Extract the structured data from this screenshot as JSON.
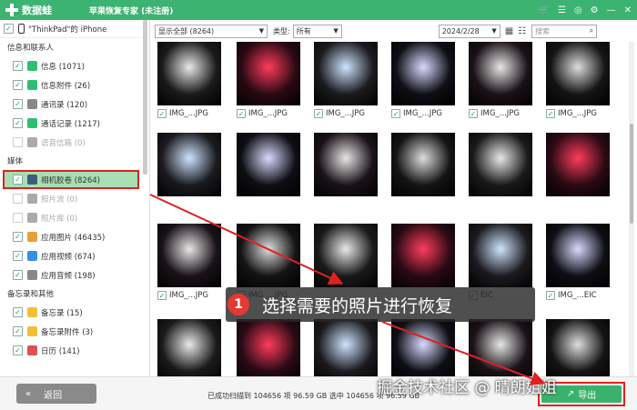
{
  "titlebar": {
    "logo_text": "数据蛙",
    "app_title": "苹果恢复专家 (未注册)",
    "controls": [
      "cart-icon",
      "menu-icon",
      "chat-icon",
      "settings-icon",
      "minimize-icon",
      "close-icon"
    ]
  },
  "device": {
    "name": "\"ThinkPad\"的 iPhone"
  },
  "sidebar": {
    "groups": [
      {
        "title": "信息和联系人",
        "items": [
          {
            "label": "信息 (1071)",
            "checked": true,
            "disabled": false,
            "icon": "message-icon",
            "color": "#2fbf71"
          },
          {
            "label": "信息附件 (26)",
            "checked": true,
            "disabled": false,
            "icon": "attachment-icon",
            "color": "#2fbf71"
          },
          {
            "label": "通讯录 (120)",
            "checked": true,
            "disabled": false,
            "icon": "contacts-icon",
            "color": "#888888"
          },
          {
            "label": "通话记录 (1217)",
            "checked": true,
            "disabled": false,
            "icon": "phone-icon",
            "color": "#2fbf71"
          },
          {
            "label": "语音信箱 (0)",
            "checked": false,
            "disabled": true,
            "icon": "voicemail-icon",
            "color": "#aaaaaa"
          }
        ]
      },
      {
        "title": "媒体",
        "items": [
          {
            "label": "相机胶卷 (8264)",
            "checked": true,
            "disabled": false,
            "icon": "camera-roll-icon",
            "color": "#3b5d7a",
            "selected": true
          },
          {
            "label": "照片流 (0)",
            "checked": false,
            "disabled": true,
            "icon": "photo-stream-icon",
            "color": "#aaaaaa"
          },
          {
            "label": "照片库 (0)",
            "checked": false,
            "disabled": true,
            "icon": "photo-library-icon",
            "color": "#aaaaaa"
          },
          {
            "label": "应用图片 (46435)",
            "checked": true,
            "disabled": false,
            "icon": "app-photos-icon",
            "color": "#e7a13a"
          },
          {
            "label": "应用视频 (674)",
            "checked": true,
            "disabled": false,
            "icon": "app-video-icon",
            "color": "#3a8fe7"
          },
          {
            "label": "应用音频 (198)",
            "checked": true,
            "disabled": false,
            "icon": "music-icon",
            "color": "#888888"
          }
        ]
      },
      {
        "title": "备忘录和其他",
        "items": [
          {
            "label": "备忘录 (15)",
            "checked": true,
            "disabled": false,
            "icon": "notes-icon",
            "color": "#f2c037"
          },
          {
            "label": "备忘录附件 (3)",
            "checked": true,
            "disabled": false,
            "icon": "notes-attachment-icon",
            "color": "#f2c037"
          },
          {
            "label": "日历 (141)",
            "checked": true,
            "disabled": false,
            "icon": "calendar-icon",
            "color": "#e05050"
          }
        ]
      }
    ]
  },
  "toolbar": {
    "filter": "显示全部 (8264)",
    "type_label": "类型:",
    "type_value": "所有",
    "date": "2024/2/28",
    "search_placeholder": "搜索"
  },
  "grid": {
    "rows": [
      {
        "caption": "IMG_...JPG",
        "captions": [
          "IMG_...JPG",
          "IMG_...JPG",
          "IMG_...JPG",
          "IMG_...JPG",
          "IMG_...JPG",
          "IMG_...JPG"
        ]
      },
      {
        "caption": "",
        "captions": [
          "",
          "",
          "",
          "",
          "",
          ""
        ]
      },
      {
        "caption": "IMG_...JPG",
        "captions": [
          "IMG_...JPG",
          "IMG_...JPG",
          "",
          "",
          "EIC",
          "IMG_...EIC"
        ]
      },
      {
        "caption": "",
        "captions": [
          "",
          "",
          "",
          "",
          "",
          ""
        ]
      }
    ]
  },
  "callout": {
    "number": "1",
    "text": "选择需要的照片进行恢复"
  },
  "bottom": {
    "back_label": "返回",
    "status": "已成功扫描到 104656 项 96.59 GB 选中 104656 项 96.59 GB",
    "export_label": "导出",
    "watermark": "掘金技术社区 @ 晴朗姐姐"
  }
}
